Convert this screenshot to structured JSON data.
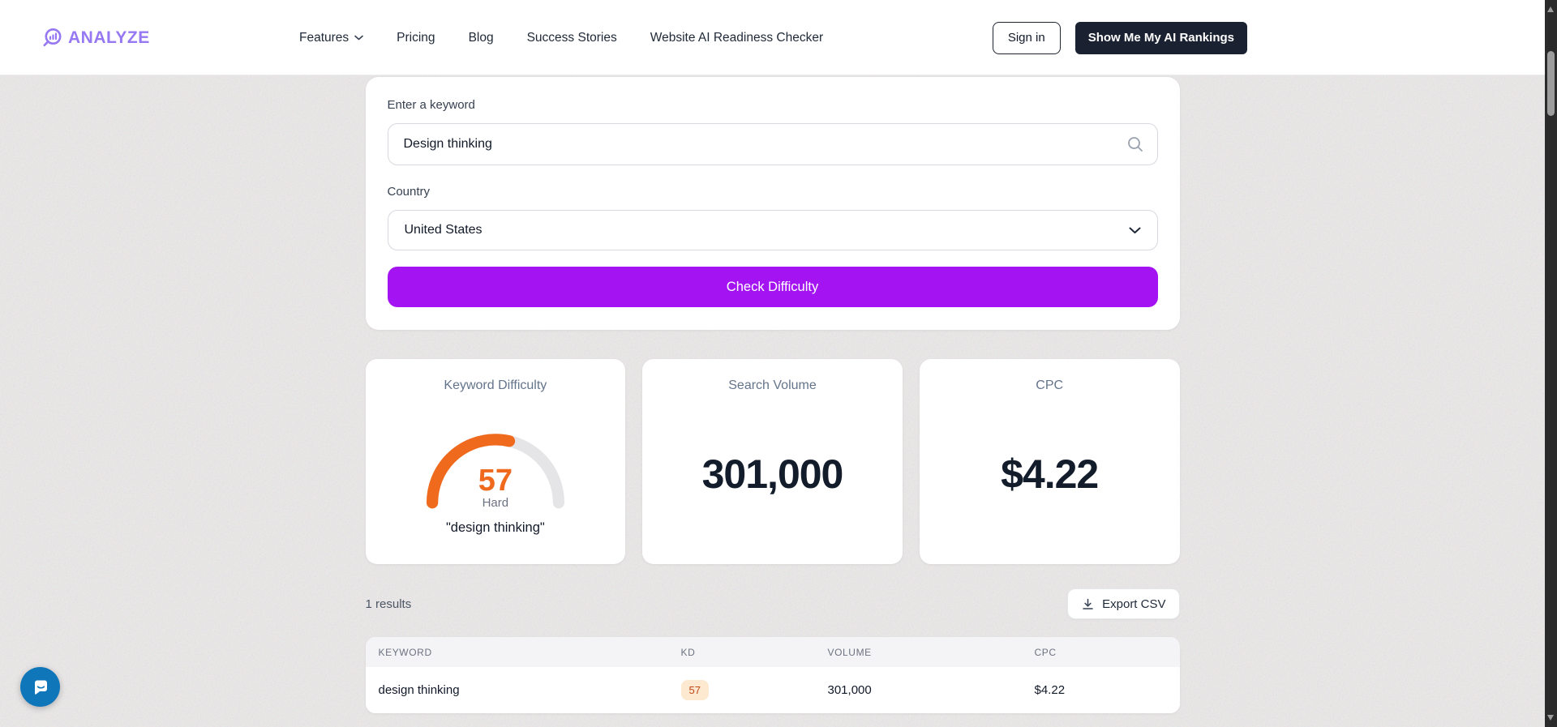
{
  "theme": {
    "accent": "#a414f2",
    "orange": "#f06a1e",
    "navy": "#1a2130",
    "brand": "#9678f2",
    "dark": "#131c2b",
    "badge_bg": "#fce9d0",
    "badge_text": "#c2481a",
    "chat_blue": "#1076ba",
    "gauge_track": "#e5e5e8"
  },
  "brand": {
    "name": "ANALYZE"
  },
  "nav": {
    "items": [
      {
        "label": "Features",
        "has_dropdown": true
      },
      {
        "label": "Pricing"
      },
      {
        "label": "Blog"
      },
      {
        "label": "Success Stories"
      },
      {
        "label": "Website AI Readiness Checker"
      }
    ],
    "sign_in": "Sign in",
    "cta": "Show Me My AI Rankings"
  },
  "form": {
    "keyword_label": "Enter a keyword",
    "keyword_value": "Design thinking",
    "country_label": "Country",
    "country_value": "United States",
    "submit_label": "Check Difficulty"
  },
  "metrics": {
    "difficulty": {
      "title": "Keyword Difficulty",
      "score": "57",
      "gauge_pct": 57,
      "label": "Hard",
      "keyword": "\"design thinking\""
    },
    "volume": {
      "title": "Search Volume",
      "value": "301,000"
    },
    "cpc": {
      "title": "CPC",
      "value": "$4.22"
    }
  },
  "results": {
    "count_text": "1 results",
    "export_label": "Export CSV",
    "table": {
      "headers": [
        "KEYWORD",
        "KD",
        "VOLUME",
        "CPC"
      ],
      "rows": [
        {
          "keyword": "design thinking",
          "kd": "57",
          "volume": "301,000",
          "cpc": "$4.22"
        }
      ]
    }
  }
}
